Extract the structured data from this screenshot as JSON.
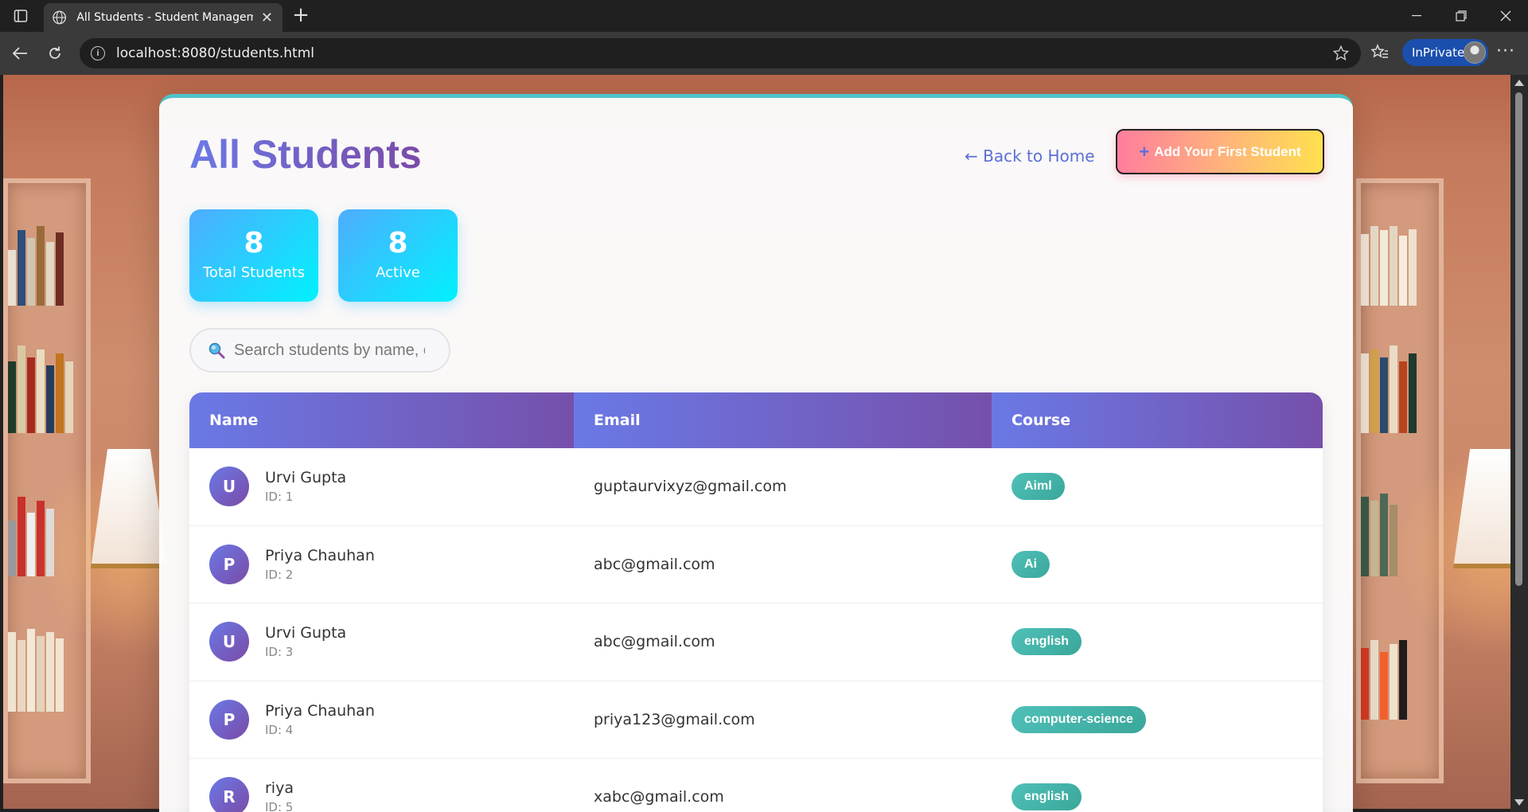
{
  "browser": {
    "tab_title": "All Students - Student Management",
    "url": "localhost:8080/students.html",
    "inprivate_label": "InPrivate"
  },
  "header": {
    "title": "All Students",
    "back_link": "← Back to Home",
    "add_button": "Add Your First Student",
    "add_icon": "+"
  },
  "stats": [
    {
      "value": "8",
      "label": "Total Students"
    },
    {
      "value": "8",
      "label": "Active"
    }
  ],
  "search": {
    "placeholder": "Search students by name, email or course"
  },
  "table": {
    "columns": [
      "Name",
      "Email",
      "Course"
    ],
    "rows": [
      {
        "initial": "U",
        "name": "Urvi Gupta",
        "id": "ID: 1",
        "email": "guptaurvixyz@gmail.com",
        "course": "Aiml"
      },
      {
        "initial": "P",
        "name": "Priya Chauhan",
        "id": "ID: 2",
        "email": "abc@gmail.com",
        "course": "Ai"
      },
      {
        "initial": "U",
        "name": "Urvi Gupta",
        "id": "ID: 3",
        "email": "abc@gmail.com",
        "course": "english"
      },
      {
        "initial": "P",
        "name": "Priya Chauhan",
        "id": "ID: 4",
        "email": "priya123@gmail.com",
        "course": "computer-science"
      },
      {
        "initial": "R",
        "name": "riya",
        "id": "ID: 5",
        "email": "xabc@gmail.com",
        "course": "english"
      }
    ]
  },
  "colors": {
    "accent_gradient_start": "#6a79e6",
    "accent_gradient_end": "#7b4aa6",
    "stat_gradient_start": "#4facfe",
    "stat_gradient_end": "#00f2fe",
    "badge": "#45b5aa",
    "card_top_border": "#4fc3c7"
  }
}
